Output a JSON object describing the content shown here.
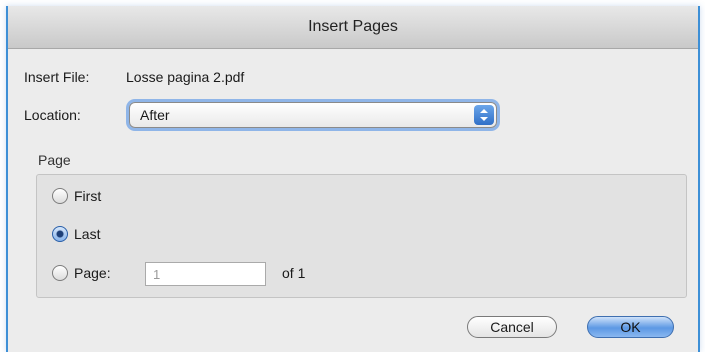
{
  "dialog": {
    "title": "Insert Pages",
    "insert_file_label": "Insert File:",
    "insert_file_name": "Losse pagina 2.pdf",
    "location_label": "Location:",
    "location_value": "After",
    "page_group_title": "Page",
    "radios": {
      "first": {
        "label": "First",
        "selected": false
      },
      "last": {
        "label": "Last",
        "selected": true
      },
      "page": {
        "label": "Page:",
        "selected": false
      }
    },
    "page_input_value": "1",
    "page_of_label": "of 1",
    "cancel_label": "Cancel",
    "ok_label": "OK"
  },
  "colors": {
    "accent": "#3d8fd6",
    "dialog_bg": "#ececec",
    "group_bg": "#e2e2e2"
  }
}
